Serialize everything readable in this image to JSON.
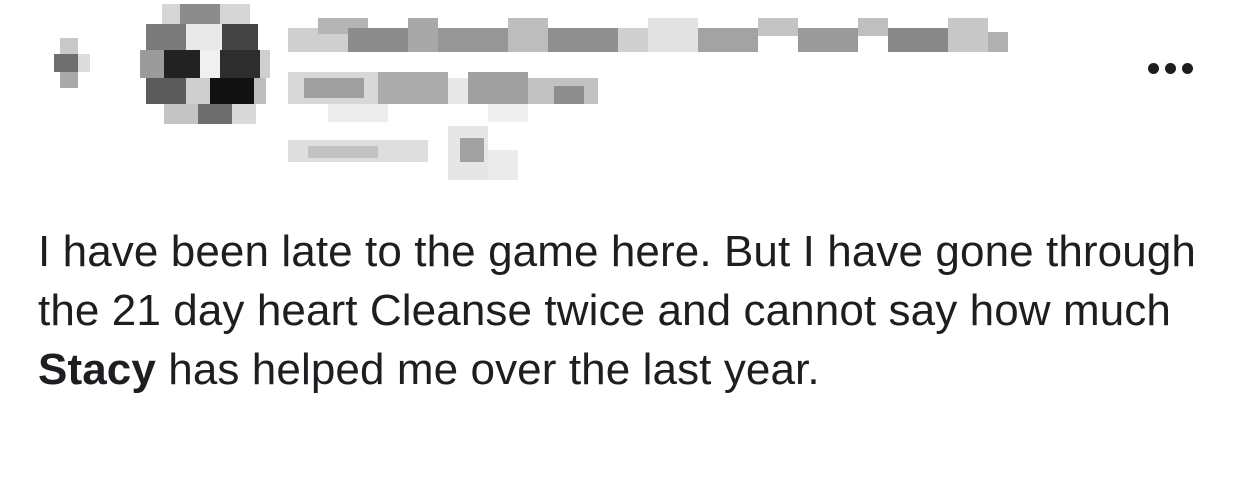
{
  "post": {
    "author_name": "",
    "more_icon": "more-horizontal-icon",
    "body": {
      "text_before_mention": "I have been late to the game here. But I have gone through the 21 day heart Cleanse twice and cannot say how much ",
      "mention": "Stacy",
      "text_after_mention": " has helped me over the last year."
    }
  },
  "colors": {
    "text": "#1c1e21",
    "background": "#ffffff",
    "pixelation_gray": "#8a8a8a"
  }
}
